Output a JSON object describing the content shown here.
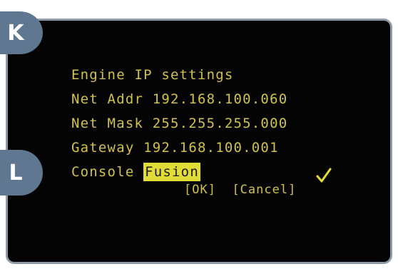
{
  "callouts": {
    "k": "K",
    "l": "L"
  },
  "lcd": {
    "title": "Engine IP settings",
    "net_addr_label": "Net Addr",
    "net_addr_value": "192.168.100.060",
    "net_mask_label": "Net Mask",
    "net_mask_value": "255.255.255.000",
    "gateway_label": "Gateway",
    "gateway_value": "192.168.100.001",
    "console_label": "Console",
    "console_value": "Fusion",
    "ok_label": "[OK]",
    "cancel_label": "[Cancel]"
  },
  "colors": {
    "lcd_text": "#d2c24a",
    "highlight": "#e1dc37",
    "callout": "#5f7791",
    "screen_bg": "#040404"
  },
  "icons": {
    "check": "checkmark-icon"
  }
}
